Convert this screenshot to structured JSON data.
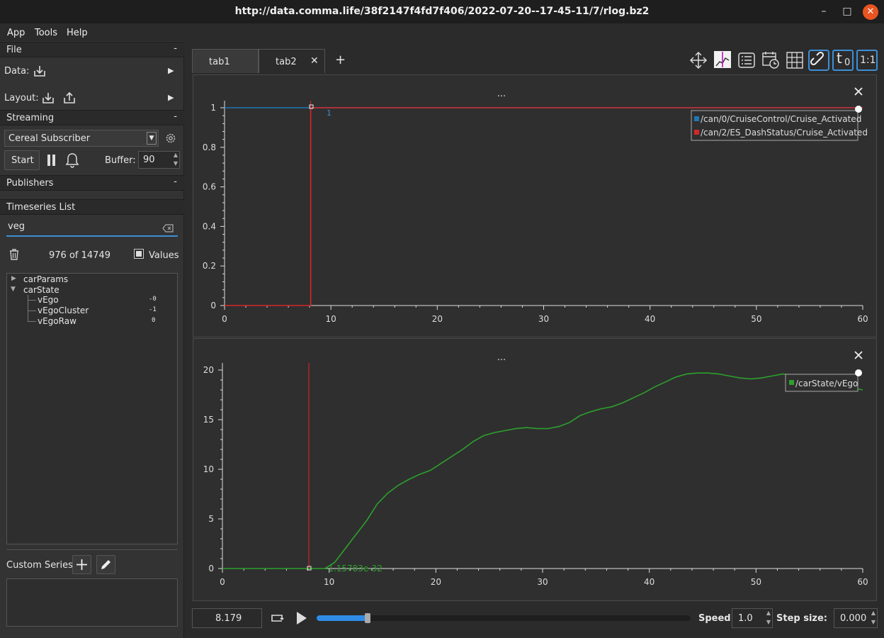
{
  "window": {
    "title": "http://data.comma.life/38f2147f4fd7f406/2022-07-20--17-45-11/7/rlog.bz2"
  },
  "menu": [
    "App",
    "Tools",
    "Help"
  ],
  "left": {
    "file_header": "File",
    "collapse": "-",
    "data_label": "Data:",
    "layout_label": "Layout:",
    "streaming_header": "Streaming",
    "subscriber": "Cereal Subscriber",
    "start_label": "Start",
    "buffer_label": "Buffer:",
    "buffer_value": "90",
    "publishers_header": "Publishers",
    "timeseries_header": "Timeseries List",
    "search_value": "veg",
    "count": "976 of 14749",
    "values_label": "Values",
    "tree": [
      {
        "name": "carParams",
        "value": ""
      },
      {
        "name": "carState",
        "value": ""
      },
      {
        "name": "vEgo",
        "value": "-0"
      },
      {
        "name": "vEgoCluster",
        "value": "-1"
      },
      {
        "name": "vEgoRaw",
        "value": "0"
      }
    ],
    "custom_series_label": "Custom Series:"
  },
  "tabs": [
    "tab1",
    "tab2"
  ],
  "tab_add": "+",
  "toolbar": {
    "t0_label": "t",
    "t0_sub": "0",
    "ratio_label": "1:1"
  },
  "plot1": {
    "title": "...",
    "yticks": [
      "1",
      "0.8",
      "0.6",
      "0.4",
      "0.2",
      "0"
    ],
    "xticks": [
      "0",
      "10",
      "20",
      "30",
      "40",
      "50",
      "60"
    ],
    "legend": [
      "/can/0/CruiseControl/Cruise_Activated",
      "/can/2/ES_DashStatus/Cruise_Activated"
    ],
    "marker_label": "1",
    "colors": {
      "series1": "#1f77b4",
      "series2": "#d62728"
    }
  },
  "plot2": {
    "title": "...",
    "yticks": [
      "20",
      "15",
      "10",
      "5",
      "0"
    ],
    "xticks": [
      "0",
      "10",
      "20",
      "30",
      "40",
      "50",
      "60"
    ],
    "legend": [
      "/carState/vEgo"
    ],
    "marker_label": "-1.15783e-32",
    "colors": {
      "series1": "#2ca02c"
    }
  },
  "chart_data": [
    {
      "type": "line",
      "title": "",
      "xlim": [
        0,
        60
      ],
      "ylim": [
        0,
        1
      ],
      "series": [
        {
          "name": "/can/0/CruiseControl/Cruise_Activated",
          "x": [
            0,
            8.1,
            8.1,
            60
          ],
          "values": [
            1,
            1,
            1,
            1
          ]
        },
        {
          "name": "/can/2/ES_DashStatus/Cruise_Activated",
          "x": [
            0,
            8.1,
            8.1,
            60
          ],
          "values": [
            0,
            0,
            1,
            1
          ]
        }
      ]
    },
    {
      "type": "line",
      "title": "",
      "xlim": [
        0,
        60
      ],
      "ylim": [
        0,
        20
      ],
      "series": [
        {
          "name": "/carState/vEgo",
          "x": [
            0,
            8.2,
            9.6,
            10.5,
            11.5,
            12.5,
            13.5,
            14.5,
            15.5,
            16.5,
            17.5,
            18.5,
            19.5,
            20.5,
            21.5,
            22.5,
            23.5,
            24.5,
            25.5,
            26.5,
            27.5,
            28.5,
            29.5,
            30.5,
            31.5,
            32.5,
            33.5,
            34.5,
            35.5,
            36.5,
            37.5,
            38.5,
            39.5,
            40.5,
            41.5,
            42.5,
            43.5,
            44.5,
            45.5,
            46.5,
            47.5,
            48.5,
            49.5,
            50.5,
            51.5,
            52.5,
            53.5,
            54.5,
            55.5,
            56.5,
            57.5,
            58.5,
            59.5,
            60
          ],
          "values": [
            0,
            0,
            0,
            0.6,
            2.0,
            3.4,
            4.8,
            6.5,
            7.6,
            8.4,
            9.0,
            9.5,
            9.9,
            10.6,
            11.3,
            12.0,
            12.8,
            13.4,
            13.7,
            13.9,
            14.1,
            14.2,
            14.1,
            14.1,
            14.3,
            14.7,
            15.4,
            15.8,
            16.1,
            16.3,
            16.7,
            17.2,
            17.7,
            18.3,
            18.8,
            19.3,
            19.6,
            19.7,
            19.7,
            19.6,
            19.4,
            19.2,
            19.1,
            19.2,
            19.4,
            19.6,
            19.5,
            19.2,
            18.9,
            18.7,
            18.5,
            18.3,
            18.1,
            18.0
          ]
        }
      ]
    }
  ],
  "bottom": {
    "time_value": "8.179",
    "progress": 0.136,
    "speed_label": "Speed:",
    "speed_value": "1.0",
    "step_label": "Step size:",
    "step_value": "0.000"
  }
}
